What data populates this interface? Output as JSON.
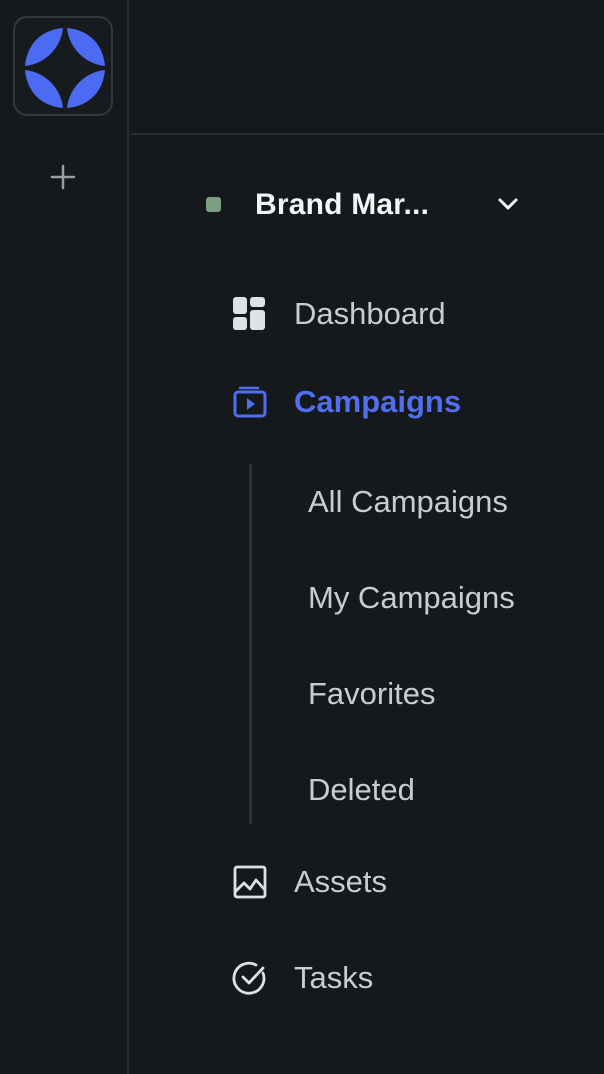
{
  "app": {
    "brand_colors": {
      "accent": "#4f6ff0",
      "workspace_dot": "#7c9f83",
      "background": "#16191b"
    }
  },
  "rail": {
    "logo_icon": "brand-logo-icon",
    "add_icon": "plus-icon"
  },
  "workspace": {
    "name": "Brand Mar...",
    "dropdown_icon": "chevron-down-icon"
  },
  "nav": {
    "items": [
      {
        "label": "Dashboard",
        "icon": "dashboard-icon",
        "active": false
      },
      {
        "label": "Campaigns",
        "icon": "campaigns-icon",
        "active": true
      },
      {
        "label": "Assets",
        "icon": "image-icon",
        "active": false
      },
      {
        "label": "Tasks",
        "icon": "check-circle-icon",
        "active": false
      }
    ],
    "campaigns_sub": [
      {
        "label": "All Campaigns"
      },
      {
        "label": "My Campaigns"
      },
      {
        "label": "Favorites"
      },
      {
        "label": "Deleted"
      }
    ]
  }
}
